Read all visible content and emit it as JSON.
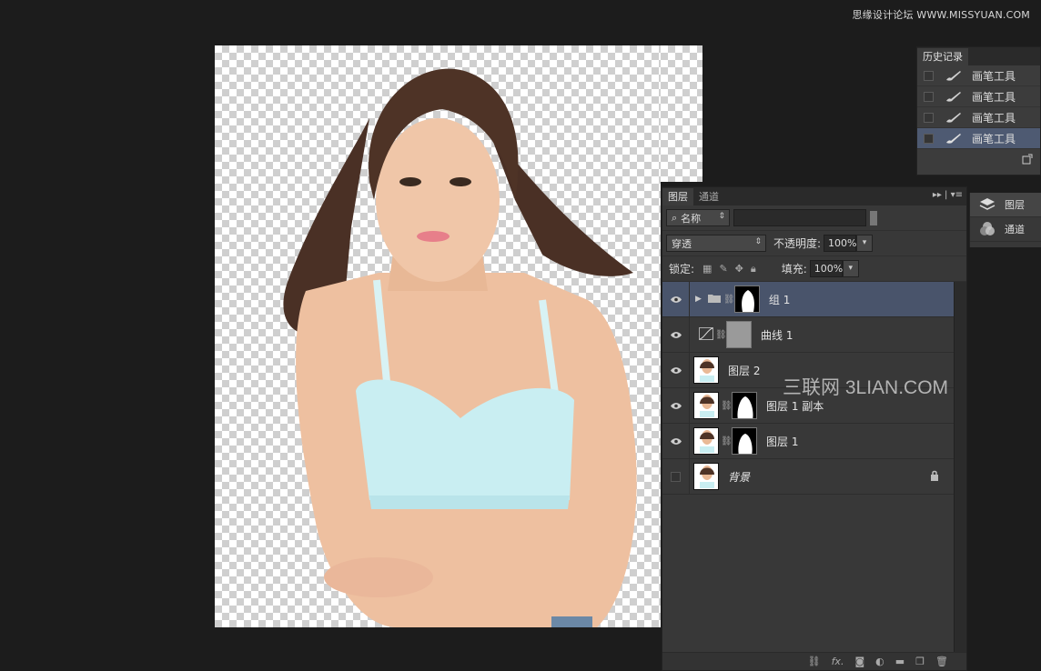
{
  "watermark_top": "思缘设计论坛 WWW.MISSYUAN.COM",
  "watermark_mid": "三联网 3LIAN.COM",
  "history": {
    "tab": "历史记录",
    "items": [
      {
        "label": "画笔工具",
        "active": false
      },
      {
        "label": "画笔工具",
        "active": false
      },
      {
        "label": "画笔工具",
        "active": false
      },
      {
        "label": "画笔工具",
        "active": true
      }
    ]
  },
  "dock": {
    "items": [
      {
        "label": "图层",
        "icon": "layers-icon"
      },
      {
        "label": "通道",
        "icon": "channels-icon"
      }
    ]
  },
  "layers": {
    "tabs": [
      "图层",
      "通道"
    ],
    "filter_select": "名称",
    "blend_mode": "穿透",
    "opacity_label": "不透明度:",
    "opacity_value": "100%",
    "lock_label": "锁定:",
    "fill_label": "填充:",
    "fill_value": "100%",
    "rows": [
      {
        "name": "组 1",
        "type": "group",
        "active": true,
        "visible": true
      },
      {
        "name": "曲线 1",
        "type": "adjustment",
        "active": false,
        "visible": true
      },
      {
        "name": "图层 2",
        "type": "image",
        "active": false,
        "visible": true
      },
      {
        "name": "图层 1 副本",
        "type": "image-mask",
        "active": false,
        "visible": true
      },
      {
        "name": "图层 1",
        "type": "image-mask",
        "active": false,
        "visible": true
      },
      {
        "name": "背景",
        "type": "background",
        "active": false,
        "visible": false
      }
    ]
  }
}
